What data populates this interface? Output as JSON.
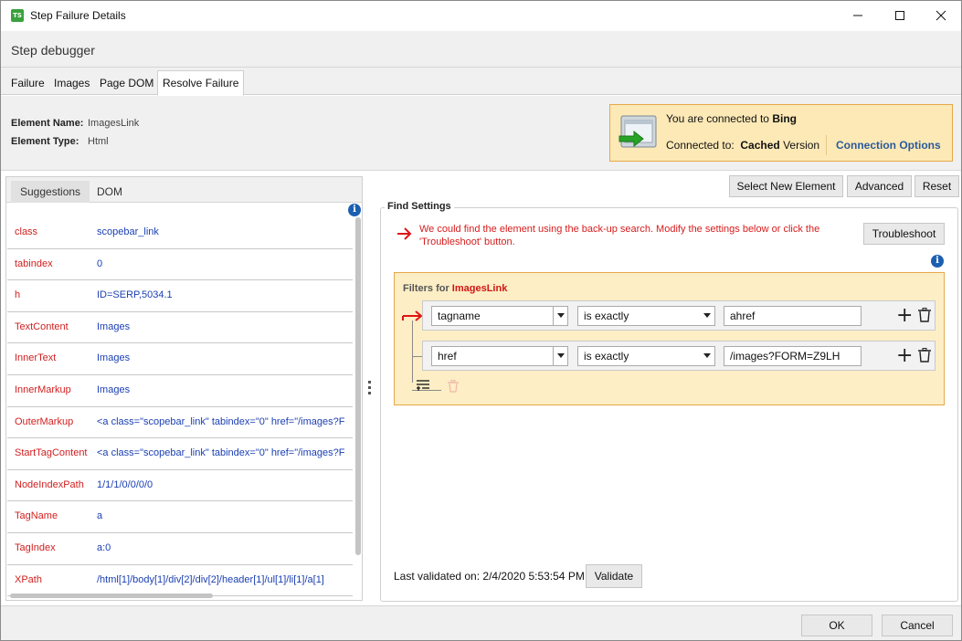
{
  "window": {
    "app_icon_text": "TS",
    "title": "Step Failure Details"
  },
  "subheader": {
    "title": "Step debugger"
  },
  "tabs": [
    {
      "label": "Failure",
      "active": false
    },
    {
      "label": "Images",
      "active": false
    },
    {
      "label": "Page DOM",
      "active": false
    },
    {
      "label": "Resolve Failure",
      "active": true
    }
  ],
  "element_info": {
    "name_label": "Element Name:",
    "name_value": "ImagesLink",
    "type_label": "Element Type:",
    "type_value": "Html"
  },
  "connection": {
    "connected_prefix": "You are connected to ",
    "connected_target": "Bing",
    "connected_to_label": "Connected to:",
    "version_bold": "Cached",
    "version_rest": " Version",
    "options_link": "Connection Options",
    "icon": "monitor-arrow-icon"
  },
  "left_panel": {
    "tabs": [
      {
        "label": "Suggestions",
        "active": true
      },
      {
        "label": "DOM",
        "active": false
      }
    ],
    "rows": [
      {
        "key": "class",
        "value": "scopebar_link"
      },
      {
        "key": "tabindex",
        "value": "0"
      },
      {
        "key": "h",
        "value": "ID=SERP,5034.1"
      },
      {
        "key": "TextContent",
        "value": "Images"
      },
      {
        "key": "InnerText",
        "value": "Images"
      },
      {
        "key": "InnerMarkup",
        "value": "Images"
      },
      {
        "key": "OuterMarkup",
        "value": "<a class=\"scopebar_link\" tabindex=\"0\" href=\"/images?F"
      },
      {
        "key": "StartTagContent",
        "value": "<a class=\"scopebar_link\" tabindex=\"0\" href=\"/images?F"
      },
      {
        "key": "NodeIndexPath",
        "value": "1/1/1/0/0/0/0"
      },
      {
        "key": "TagName",
        "value": "a"
      },
      {
        "key": "TagIndex",
        "value": "a:0"
      },
      {
        "key": "XPath",
        "value": "/html[1]/body[1]/div[2]/div[2]/header[1]/ul[1]/li[1]/a[1]"
      }
    ]
  },
  "toolbar": {
    "select_new_element": "Select New Element",
    "advanced": "Advanced",
    "reset": "Reset"
  },
  "find_settings": {
    "title": "Find Settings",
    "warning": "We could find the element using the back-up search. Modify the settings below or click the 'Troubleshoot' button.",
    "troubleshoot_button": "Troubleshoot",
    "filters_prefix": "Filters for ",
    "filters_target": "ImagesLink",
    "filters": [
      {
        "attribute": "tagname",
        "operator": "is exactly",
        "value": "ahref",
        "active": true
      },
      {
        "attribute": "href",
        "operator": "is exactly",
        "value": "/images?FORM=Z9LH",
        "active": false
      }
    ],
    "last_validated": "Last validated on: 2/4/2020 5:53:54 PM",
    "validate_button": "Validate"
  },
  "footer": {
    "ok": "OK",
    "cancel": "Cancel"
  },
  "colors": {
    "key_red": "#d12020",
    "value_blue": "#1a3fb3",
    "warning_red": "#d61c1c",
    "accent_orange": "#e5a94a",
    "panel_yellow": "#fdeec5",
    "link_blue": "#2a5a9a"
  }
}
